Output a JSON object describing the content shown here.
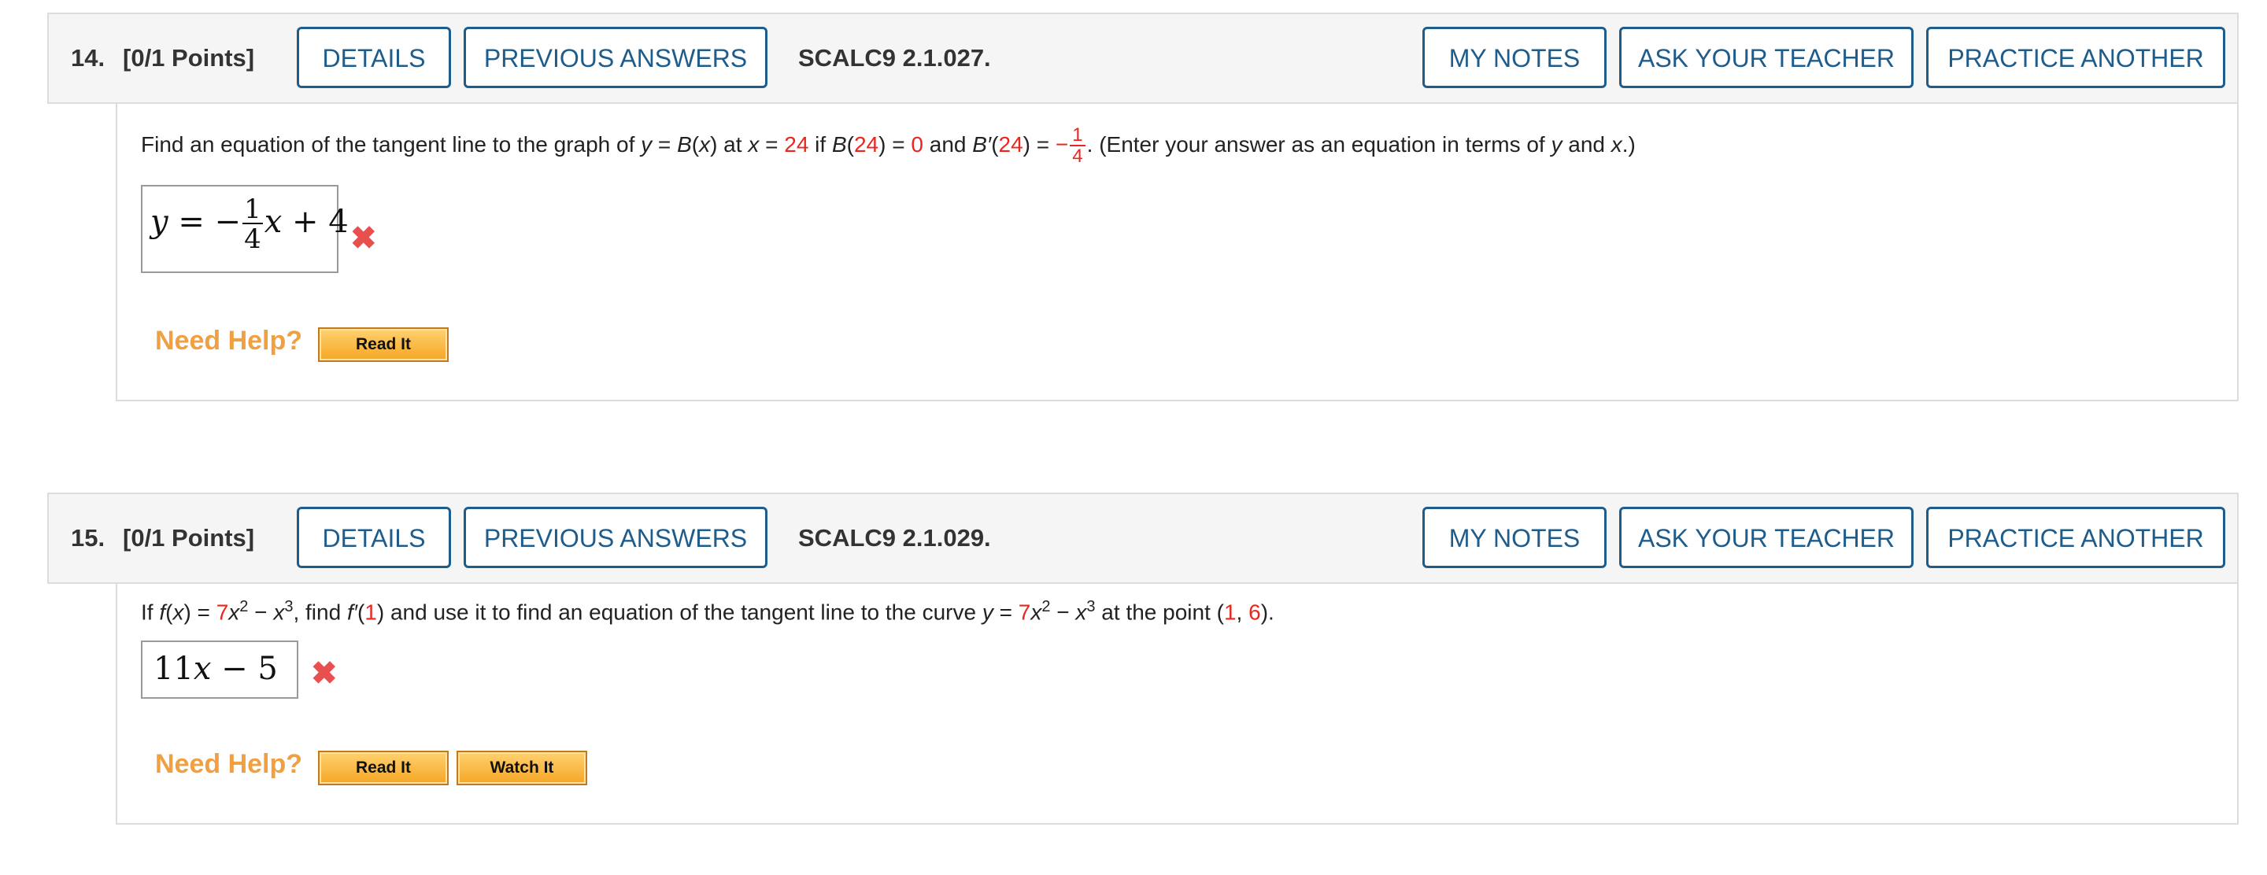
{
  "questions": [
    {
      "number": "14.",
      "points": "[0/1 Points]",
      "code": "SCALC9 2.1.027.",
      "buttons": {
        "details": "DETAILS",
        "previous_answers": "PREVIOUS ANSWERS",
        "my_notes": "MY NOTES",
        "ask_teacher": "ASK YOUR TEACHER",
        "practice_another": "PRACTICE ANOTHER"
      },
      "prompt": {
        "t1": "Find an equation of the tangent line to the graph of ",
        "y": "y",
        "eq1": " = ",
        "B": "B",
        "lp": "(",
        "x": "x",
        "rp": ")",
        "at": " at ",
        "x2": "x",
        "eq2": " = ",
        "x_val": "24",
        "if": " if ",
        "B2": "B",
        "lp2": "(",
        "b_arg": "24",
        "rp2": ")",
        "eq3": " = ",
        "b_val": "0",
        "and": " and ",
        "Bp": "B′",
        "lp3": "(",
        "bp_arg": "24",
        "rp3": ")",
        "eq4": " = ",
        "neg": "−",
        "frac_n": "1",
        "frac_d": "4",
        "t2": ". (Enter your answer as an equation in terms of ",
        "y2": "y",
        "and2": " and ",
        "x3": "x",
        "t3": ".)"
      },
      "answer": {
        "lhs": "y",
        "eq": " = −",
        "frac_n": "1",
        "frac_d": "4",
        "x": "x",
        "rest": " + 4"
      },
      "status_icon": "x-mark-icon",
      "need_help": "Need Help?",
      "help_buttons": [
        "Read It"
      ]
    },
    {
      "number": "15.",
      "points": "[0/1 Points]",
      "code": "SCALC9 2.1.029.",
      "buttons": {
        "details": "DETAILS",
        "previous_answers": "PREVIOUS ANSWERS",
        "my_notes": "MY NOTES",
        "ask_teacher": "ASK YOUR TEACHER",
        "practice_another": "PRACTICE ANOTHER"
      },
      "prompt": {
        "t1": "If ",
        "f": "f",
        "lp": "(",
        "x": "x",
        "rp": ")",
        "eq1": " = ",
        "c1": "7",
        "x2": "x",
        "p2": "2",
        "minus": " − ",
        "x3": "x",
        "p3": "3",
        "find": ", find ",
        "fp": "f′",
        "lp2": "(",
        "arg": "1",
        "rp2": ")",
        "t2": " and use it to find an equation of the tangent line to the curve ",
        "y": "y",
        "eq2": " = ",
        "c2": "7",
        "x4": "x",
        "p4": "2",
        "minus2": " − ",
        "x5": "x",
        "p5": "3",
        "t3": " at the point (",
        "pt1": "1",
        "comma": ", ",
        "pt2": "6",
        "t4": ")."
      },
      "answer": {
        "value_a": "11",
        "x": "x",
        "value_b": " − 5"
      },
      "status_icon": "x-mark-icon",
      "need_help": "Need Help?",
      "help_buttons": [
        "Read It",
        "Watch It"
      ]
    }
  ],
  "colors": {
    "accent": "#1e5c8c",
    "given_value": "#e8271e",
    "incorrect": "#e85050",
    "need_help": "#f0a040",
    "help_button": "#f5a623"
  }
}
